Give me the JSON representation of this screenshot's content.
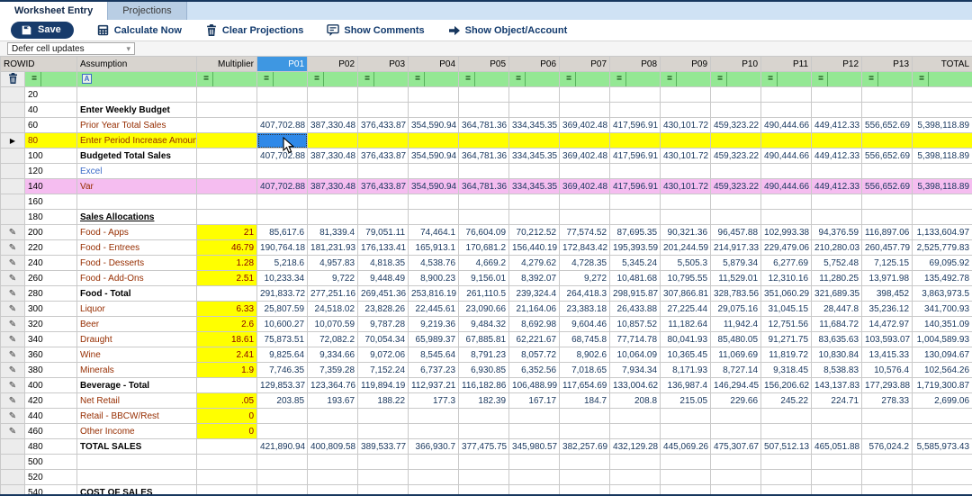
{
  "tabs": [
    {
      "label": "Worksheet Entry",
      "active": true
    },
    {
      "label": "Projections",
      "active": false
    }
  ],
  "toolbar": {
    "save_label": "Save",
    "calculate_label": "Calculate Now",
    "clear_label": "Clear Projections",
    "comments_label": "Show Comments",
    "object_account_label": "Show Object/Account"
  },
  "dropdown": {
    "value": "Defer cell updates"
  },
  "grid": {
    "headers": {
      "rowid": "ROWID",
      "assumption": "Assumption",
      "multiplier": "Multiplier",
      "periods": [
        "P01",
        "P02",
        "P03",
        "P04",
        "P05",
        "P06",
        "P07",
        "P08",
        "P09",
        "P10",
        "P11",
        "P12",
        "P13"
      ],
      "total": "TOTAL",
      "selected_period_index": 0
    },
    "filter_operator": "=",
    "rows": [
      {
        "id": "20",
        "label": "",
        "style": "detail",
        "icon": "",
        "bg": "",
        "mult": "",
        "vals": null,
        "total": ""
      },
      {
        "id": "40",
        "label": "Enter Weekly Budget",
        "style": "bold",
        "icon": "",
        "bg": "",
        "mult": "",
        "vals": null,
        "total": ""
      },
      {
        "id": "60",
        "label": "Prior Year Total Sales",
        "style": "detail",
        "icon": "",
        "bg": "",
        "mult": "",
        "vals": [
          "407,702.88",
          "387,330.48",
          "376,433.87",
          "354,590.94",
          "364,781.36",
          "334,345.35",
          "369,402.48",
          "417,596.91",
          "430,101.72",
          "459,323.22",
          "490,444.66",
          "449,412.33",
          "556,652.69"
        ],
        "total": "5,398,118.89"
      },
      {
        "id": "80",
        "label": "Enter Period Increase Amount",
        "style": "detail",
        "icon": "arrow",
        "bg": "yellow",
        "mult": "",
        "vals": null,
        "total": "",
        "selected_cell": 0
      },
      {
        "id": "100",
        "label": "Budgeted Total Sales",
        "style": "bold",
        "icon": "",
        "bg": "",
        "mult": "",
        "vals": [
          "407,702.88",
          "387,330.48",
          "376,433.87",
          "354,590.94",
          "364,781.36",
          "334,345.35",
          "369,402.48",
          "417,596.91",
          "430,101.72",
          "459,323.22",
          "490,444.66",
          "449,412.33",
          "556,652.69"
        ],
        "total": "5,398,118.89"
      },
      {
        "id": "120",
        "label": "Excel",
        "style": "blue",
        "icon": "",
        "bg": "",
        "mult": "",
        "vals": null,
        "total": ""
      },
      {
        "id": "140",
        "label": "Var",
        "style": "var",
        "icon": "",
        "bg": "pink",
        "mult": "",
        "vals": [
          "407,702.88",
          "387,330.48",
          "376,433.87",
          "354,590.94",
          "364,781.36",
          "334,345.35",
          "369,402.48",
          "417,596.91",
          "430,101.72",
          "459,323.22",
          "490,444.66",
          "449,412.33",
          "556,652.69"
        ],
        "total": "5,398,118.89"
      },
      {
        "id": "160",
        "label": "",
        "style": "detail",
        "icon": "",
        "bg": "",
        "mult": "",
        "vals": null,
        "total": ""
      },
      {
        "id": "180",
        "label": "Sales Allocations",
        "style": "bold-u",
        "icon": "",
        "bg": "",
        "mult": "",
        "vals": null,
        "total": ""
      },
      {
        "id": "200",
        "label": "Food - Apps",
        "style": "detail",
        "icon": "pencil",
        "bg": "",
        "mult": "21",
        "vals": [
          "85,617.6",
          "81,339.4",
          "79,051.11",
          "74,464.1",
          "76,604.09",
          "70,212.52",
          "77,574.52",
          "87,695.35",
          "90,321.36",
          "96,457.88",
          "102,993.38",
          "94,376.59",
          "116,897.06"
        ],
        "total": "1,133,604.97"
      },
      {
        "id": "220",
        "label": "Food - Entrees",
        "style": "detail",
        "icon": "pencil",
        "bg": "",
        "mult": "46.79",
        "vals": [
          "190,764.18",
          "181,231.93",
          "176,133.41",
          "165,913.1",
          "170,681.2",
          "156,440.19",
          "172,843.42",
          "195,393.59",
          "201,244.59",
          "214,917.33",
          "229,479.06",
          "210,280.03",
          "260,457.79"
        ],
        "total": "2,525,779.83"
      },
      {
        "id": "240",
        "label": "Food - Desserts",
        "style": "detail",
        "icon": "pencil",
        "bg": "",
        "mult": "1.28",
        "vals": [
          "5,218.6",
          "4,957.83",
          "4,818.35",
          "4,538.76",
          "4,669.2",
          "4,279.62",
          "4,728.35",
          "5,345.24",
          "5,505.3",
          "5,879.34",
          "6,277.69",
          "5,752.48",
          "7,125.15"
        ],
        "total": "69,095.92"
      },
      {
        "id": "260",
        "label": "Food - Add-Ons",
        "style": "detail",
        "icon": "pencil",
        "bg": "",
        "mult": "2.51",
        "vals": [
          "10,233.34",
          "9,722",
          "9,448.49",
          "8,900.23",
          "9,156.01",
          "8,392.07",
          "9,272",
          "10,481.68",
          "10,795.55",
          "11,529.01",
          "12,310.16",
          "11,280.25",
          "13,971.98"
        ],
        "total": "135,492.78"
      },
      {
        "id": "280",
        "label": "Food - Total",
        "style": "subtotal",
        "icon": "pencil",
        "bg": "",
        "mult": "",
        "vals": [
          "291,833.72",
          "277,251.16",
          "269,451.36",
          "253,816.19",
          "261,110.5",
          "239,324.4",
          "264,418.3",
          "298,915.87",
          "307,866.81",
          "328,783.56",
          "351,060.29",
          "321,689.35",
          "398,452"
        ],
        "total": "3,863,973.5"
      },
      {
        "id": "300",
        "label": "Liquor",
        "style": "detail",
        "icon": "pencil",
        "bg": "",
        "mult": "6.33",
        "vals": [
          "25,807.59",
          "24,518.02",
          "23,828.26",
          "22,445.61",
          "23,090.66",
          "21,164.06",
          "23,383.18",
          "26,433.88",
          "27,225.44",
          "29,075.16",
          "31,045.15",
          "28,447.8",
          "35,236.12"
        ],
        "total": "341,700.93"
      },
      {
        "id": "320",
        "label": "Beer",
        "style": "detail",
        "icon": "pencil",
        "bg": "",
        "mult": "2.6",
        "vals": [
          "10,600.27",
          "10,070.59",
          "9,787.28",
          "9,219.36",
          "9,484.32",
          "8,692.98",
          "9,604.46",
          "10,857.52",
          "11,182.64",
          "11,942.4",
          "12,751.56",
          "11,684.72",
          "14,472.97"
        ],
        "total": "140,351.09"
      },
      {
        "id": "340",
        "label": "Draught",
        "style": "detail",
        "icon": "pencil",
        "bg": "",
        "mult": "18.61",
        "vals": [
          "75,873.51",
          "72,082.2",
          "70,054.34",
          "65,989.37",
          "67,885.81",
          "62,221.67",
          "68,745.8",
          "77,714.78",
          "80,041.93",
          "85,480.05",
          "91,271.75",
          "83,635.63",
          "103,593.07"
        ],
        "total": "1,004,589.93"
      },
      {
        "id": "360",
        "label": "Wine",
        "style": "detail",
        "icon": "pencil",
        "bg": "",
        "mult": "2.41",
        "vals": [
          "9,825.64",
          "9,334.66",
          "9,072.06",
          "8,545.64",
          "8,791.23",
          "8,057.72",
          "8,902.6",
          "10,064.09",
          "10,365.45",
          "11,069.69",
          "11,819.72",
          "10,830.84",
          "13,415.33"
        ],
        "total": "130,094.67"
      },
      {
        "id": "380",
        "label": "Minerals",
        "style": "detail",
        "icon": "pencil",
        "bg": "",
        "mult": "1.9",
        "vals": [
          "7,746.35",
          "7,359.28",
          "7,152.24",
          "6,737.23",
          "6,930.85",
          "6,352.56",
          "7,018.65",
          "7,934.34",
          "8,171.93",
          "8,727.14",
          "9,318.45",
          "8,538.83",
          "10,576.4"
        ],
        "total": "102,564.26"
      },
      {
        "id": "400",
        "label": "Beverage - Total",
        "style": "subtotal",
        "icon": "pencil",
        "bg": "",
        "mult": "",
        "vals": [
          "129,853.37",
          "123,364.76",
          "119,894.19",
          "112,937.21",
          "116,182.86",
          "106,488.99",
          "117,654.69",
          "133,004.62",
          "136,987.4",
          "146,294.45",
          "156,206.62",
          "143,137.83",
          "177,293.88"
        ],
        "total": "1,719,300.87"
      },
      {
        "id": "420",
        "label": "Net Retail",
        "style": "detail",
        "icon": "pencil",
        "bg": "",
        "mult": ".05",
        "vals": [
          "203.85",
          "193.67",
          "188.22",
          "177.3",
          "182.39",
          "167.17",
          "184.7",
          "208.8",
          "215.05",
          "229.66",
          "245.22",
          "224.71",
          "278.33"
        ],
        "total": "2,699.06"
      },
      {
        "id": "440",
        "label": "Retail - BBCW/Rest",
        "style": "detail",
        "icon": "pencil",
        "bg": "",
        "mult": "0",
        "vals": null,
        "total": ""
      },
      {
        "id": "460",
        "label": "Other Income",
        "style": "detail",
        "icon": "pencil",
        "bg": "",
        "mult": "0",
        "vals": null,
        "total": ""
      },
      {
        "id": "480",
        "label": "TOTAL SALES",
        "style": "bold",
        "icon": "",
        "bg": "",
        "mult": "",
        "vals": [
          "421,890.94",
          "400,809.58",
          "389,533.77",
          "366,930.7",
          "377,475.75",
          "345,980.57",
          "382,257.69",
          "432,129.28",
          "445,069.26",
          "475,307.67",
          "507,512.13",
          "465,051.88",
          "576,024.2"
        ],
        "total": "5,585,973.43"
      },
      {
        "id": "500",
        "label": "",
        "style": "detail",
        "icon": "",
        "bg": "",
        "mult": "",
        "vals": null,
        "total": ""
      },
      {
        "id": "520",
        "label": "",
        "style": "detail",
        "icon": "",
        "bg": "",
        "mult": "",
        "vals": null,
        "total": ""
      },
      {
        "id": "540",
        "label": "COST OF SALES",
        "style": "bold",
        "icon": "",
        "bg": "",
        "mult": "",
        "vals": null,
        "total": ""
      }
    ]
  },
  "colors": {
    "accent_navy": "#17375e",
    "selected_cell_blue": "#2f89e8",
    "selected_header_blue": "#3e97e2",
    "filter_green": "#94e894",
    "row_yellow": "#ffff00",
    "row_pink": "#f5bdf0",
    "detail_red": "#962d00",
    "value_navy": "#17365d"
  }
}
